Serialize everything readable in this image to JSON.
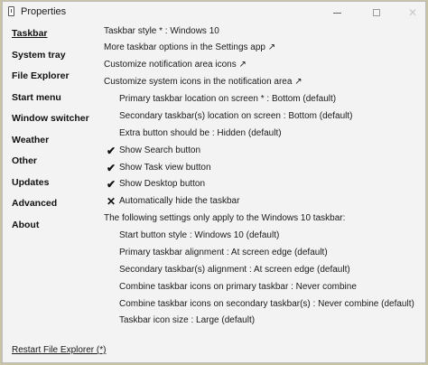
{
  "window": {
    "title": "Properties",
    "controls": {
      "minimize": "minimize-icon",
      "maximize": "maximize-icon",
      "close": "close-icon"
    }
  },
  "nav": [
    {
      "label": "Taskbar",
      "active": true
    },
    {
      "label": "System tray"
    },
    {
      "label": "File Explorer"
    },
    {
      "label": "Start menu"
    },
    {
      "label": "Window switcher"
    },
    {
      "label": "Weather"
    },
    {
      "label": "Other"
    },
    {
      "label": "Updates"
    },
    {
      "label": "Advanced"
    },
    {
      "label": "About"
    }
  ],
  "settings": {
    "taskbar_style": "Taskbar style * : Windows 10",
    "more_options": "More taskbar options in the Settings app ↗",
    "customize_notification": "Customize notification area icons ↗",
    "customize_system_icons": "Customize system icons in the notification area ↗",
    "primary_location": "Primary taskbar location on screen * : Bottom (default)",
    "secondary_location": "Secondary taskbar(s) location on screen : Bottom (default)",
    "extra_button": "Extra button should be : Hidden (default)",
    "show_search": "Show Search button",
    "show_task_view": "Show Task view button",
    "show_desktop": "Show Desktop button",
    "auto_hide": "Automatically hide the taskbar",
    "win10_note": "The following settings only apply to the Windows 10 taskbar:",
    "start_button_style": "Start button style : Windows 10 (default)",
    "primary_alignment": "Primary taskbar alignment : At screen edge (default)",
    "secondary_alignment": "Secondary taskbar(s) alignment : At screen edge (default)",
    "combine_primary": "Combine taskbar icons on primary taskbar : Never combine",
    "combine_secondary": "Combine taskbar icons on secondary taskbar(s) : Never combine (default)",
    "icon_size": "Taskbar icon size : Large (default)"
  },
  "marks": {
    "show_search": "✔",
    "show_task_view": "✔",
    "show_desktop": "✔",
    "auto_hide": "✕"
  },
  "footer": {
    "restart_label": "Restart File Explorer (*)"
  }
}
